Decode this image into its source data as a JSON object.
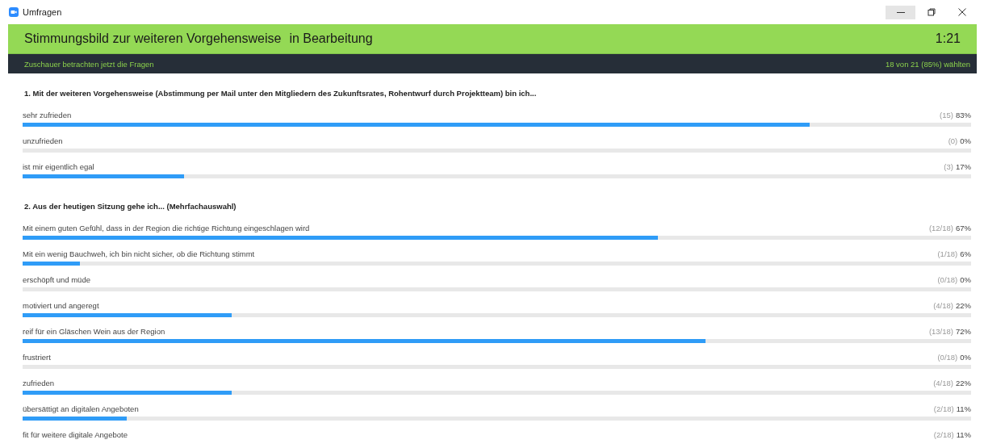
{
  "window": {
    "title": "Umfragen"
  },
  "header": {
    "poll_title": "Stimmungsbild zur weiteren Vorgehensweise",
    "status": "in Bearbeitung",
    "timer": "1:21"
  },
  "info_bar": {
    "message": "Zuschauer betrachten jetzt die Fragen",
    "participation": "18 von 21 (85%) wählten"
  },
  "questions": [
    {
      "title": "1. Mit der weiteren Vorgehensweise (Abstimmung per Mail unter den Mitgliedern des Zukunftsrates, Rohentwurf durch Projektteam) bin ich...",
      "options": [
        {
          "label": "sehr zufrieden",
          "count": "(15)",
          "percent": "83%",
          "level": 0.83
        },
        {
          "label": "unzufrieden",
          "count": "(0)",
          "percent": "0%",
          "level": 0
        },
        {
          "label": "ist mir eigentlich egal",
          "count": "(3)",
          "percent": "17%",
          "level": 0.17
        }
      ]
    },
    {
      "title": "2. Aus der heutigen Sitzung gehe ich... (Mehrfachauswahl)",
      "options": [
        {
          "label": "Mit einem guten Gefühl, dass in der Region die richtige Richtung eingeschlagen wird",
          "count": "(12/18)",
          "percent": "67%",
          "level": 0.67
        },
        {
          "label": "Mit ein wenig Bauchweh, ich bin nicht sicher, ob die Richtung stimmt",
          "count": "(1/18)",
          "percent": "6%",
          "level": 0.06
        },
        {
          "label": "erschöpft und müde",
          "count": "(0/18)",
          "percent": "0%",
          "level": 0
        },
        {
          "label": "motiviert und angeregt",
          "count": "(4/18)",
          "percent": "22%",
          "level": 0.22
        },
        {
          "label": "reif für ein Gläschen Wein aus der Region",
          "count": "(13/18)",
          "percent": "72%",
          "level": 0.72
        },
        {
          "label": "frustriert",
          "count": "(0/18)",
          "percent": "0%",
          "level": 0
        },
        {
          "label": "zufrieden",
          "count": "(4/18)",
          "percent": "22%",
          "level": 0.22
        },
        {
          "label": "übersättigt an digitalen Angeboten",
          "count": "(2/18)",
          "percent": "11%",
          "level": 0.11
        },
        {
          "label": "fit für weitere digitale Angebote",
          "count": "(2/18)",
          "percent": "11%"
        }
      ]
    }
  ]
}
